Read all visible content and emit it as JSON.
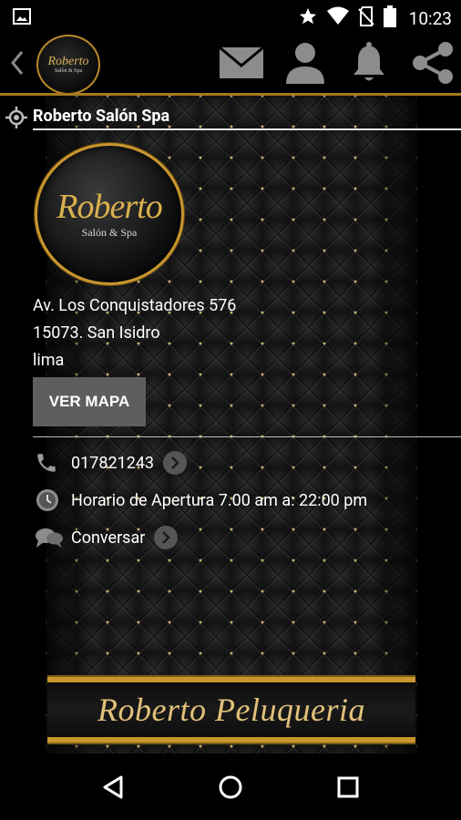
{
  "status_bar": {
    "time": "10:23",
    "icons": [
      "image-icon",
      "star-icon",
      "wifi-icon",
      "no-sim-icon",
      "battery-icon"
    ]
  },
  "app_bar": {
    "logo": {
      "title": "Roberto",
      "subtitle": "Salón & Spa"
    },
    "actions": [
      "mail-icon",
      "person-icon",
      "bell-icon",
      "share-icon"
    ]
  },
  "business": {
    "name": "Roberto Salón Spa",
    "logo": {
      "title": "Roberto",
      "subtitle": "Salón  & Spa"
    },
    "address": {
      "line1": "Av. Los Conquistadores  576",
      "line2": "15073. San Isidro",
      "line3": "lima"
    },
    "map_button": "VER MAPA",
    "phone": "017821243",
    "hours": "Horario de Apertura 7.00 am a: 22:00 pm",
    "chat": "Conversar",
    "banner": "Roberto Peluqueria"
  },
  "colors": {
    "gold": "#c9962e",
    "button_gray": "#5e5e5e"
  }
}
